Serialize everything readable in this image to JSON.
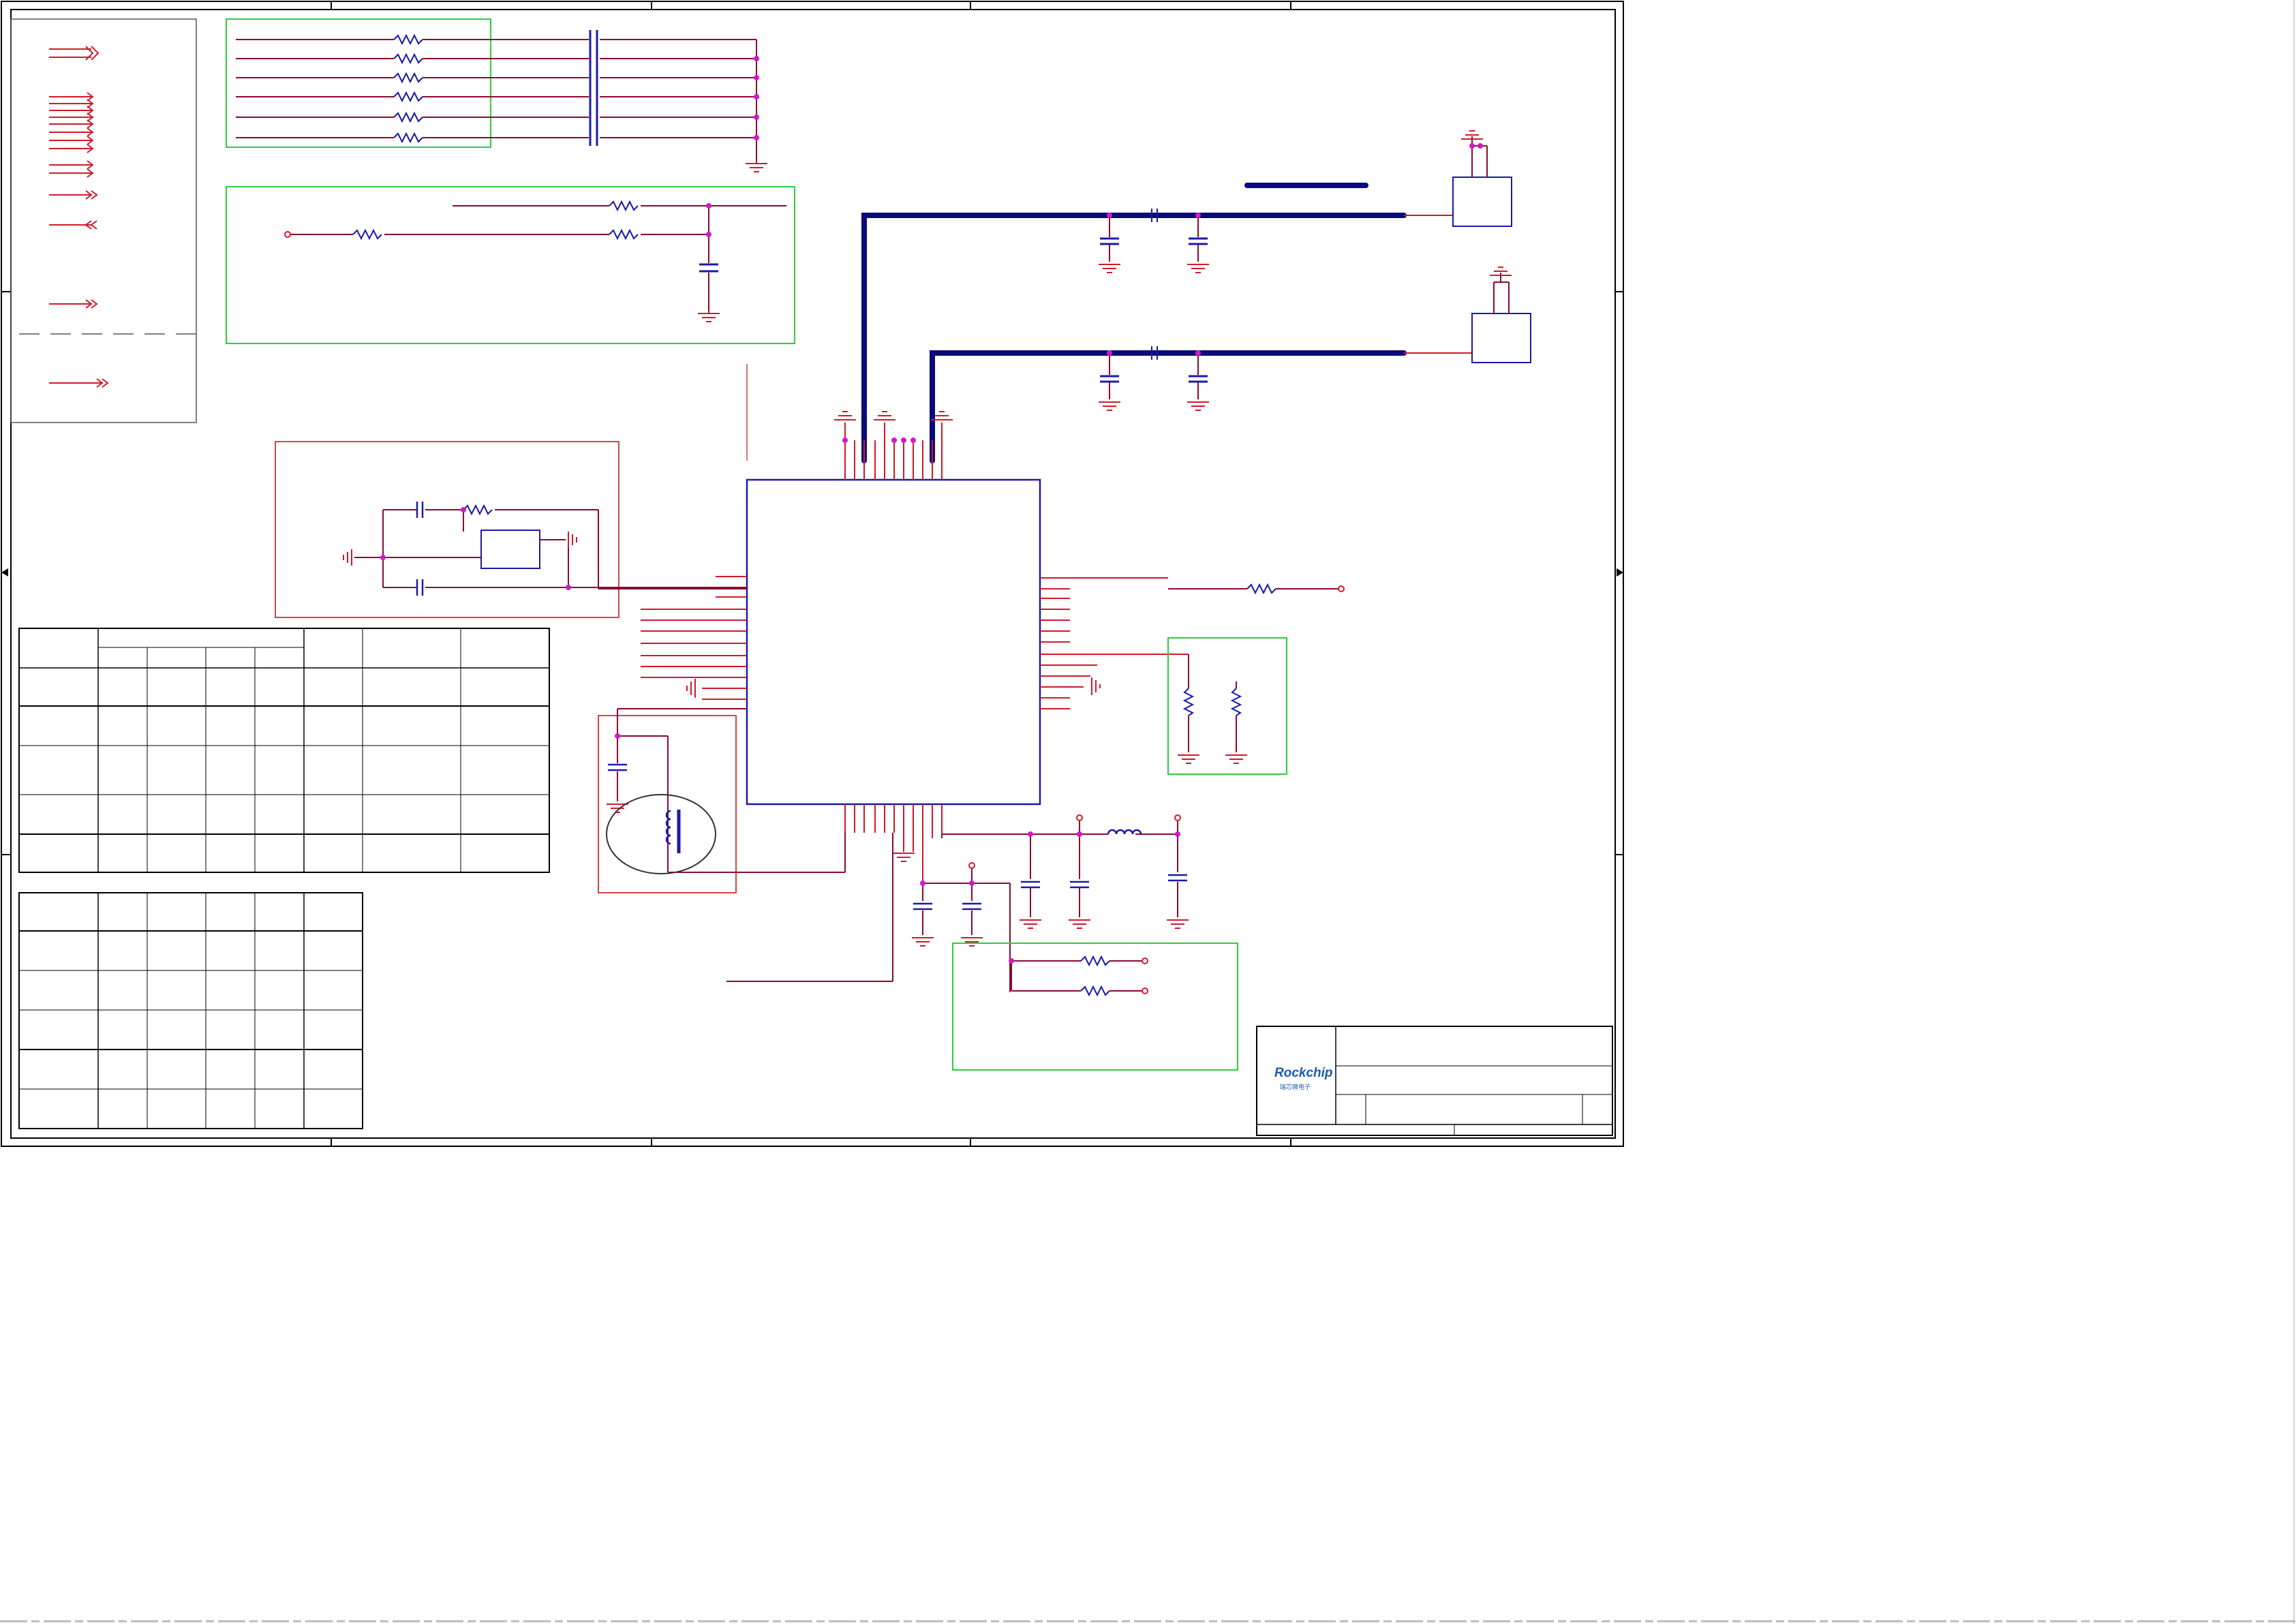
{
  "title_block": {
    "brand": "Rockchip",
    "brand_sub": "瑞芯微电子"
  },
  "colors": {
    "border": "#000000",
    "wire": "#8b0a2e",
    "pin": "#e0152a",
    "bus": "#0a0a7a",
    "component": "#1a1aa8",
    "junction": "#d418c8",
    "group_green": "#2ecc40",
    "group_red": "#d64545",
    "brand": "#1b5bb0"
  },
  "icons": [
    "gnd-symbol",
    "resistor-symbol",
    "capacitor-symbol",
    "inductor-symbol",
    "antenna-symbol",
    "offpage-connector-icon",
    "crystal-symbol",
    "rockchip-logo"
  ]
}
